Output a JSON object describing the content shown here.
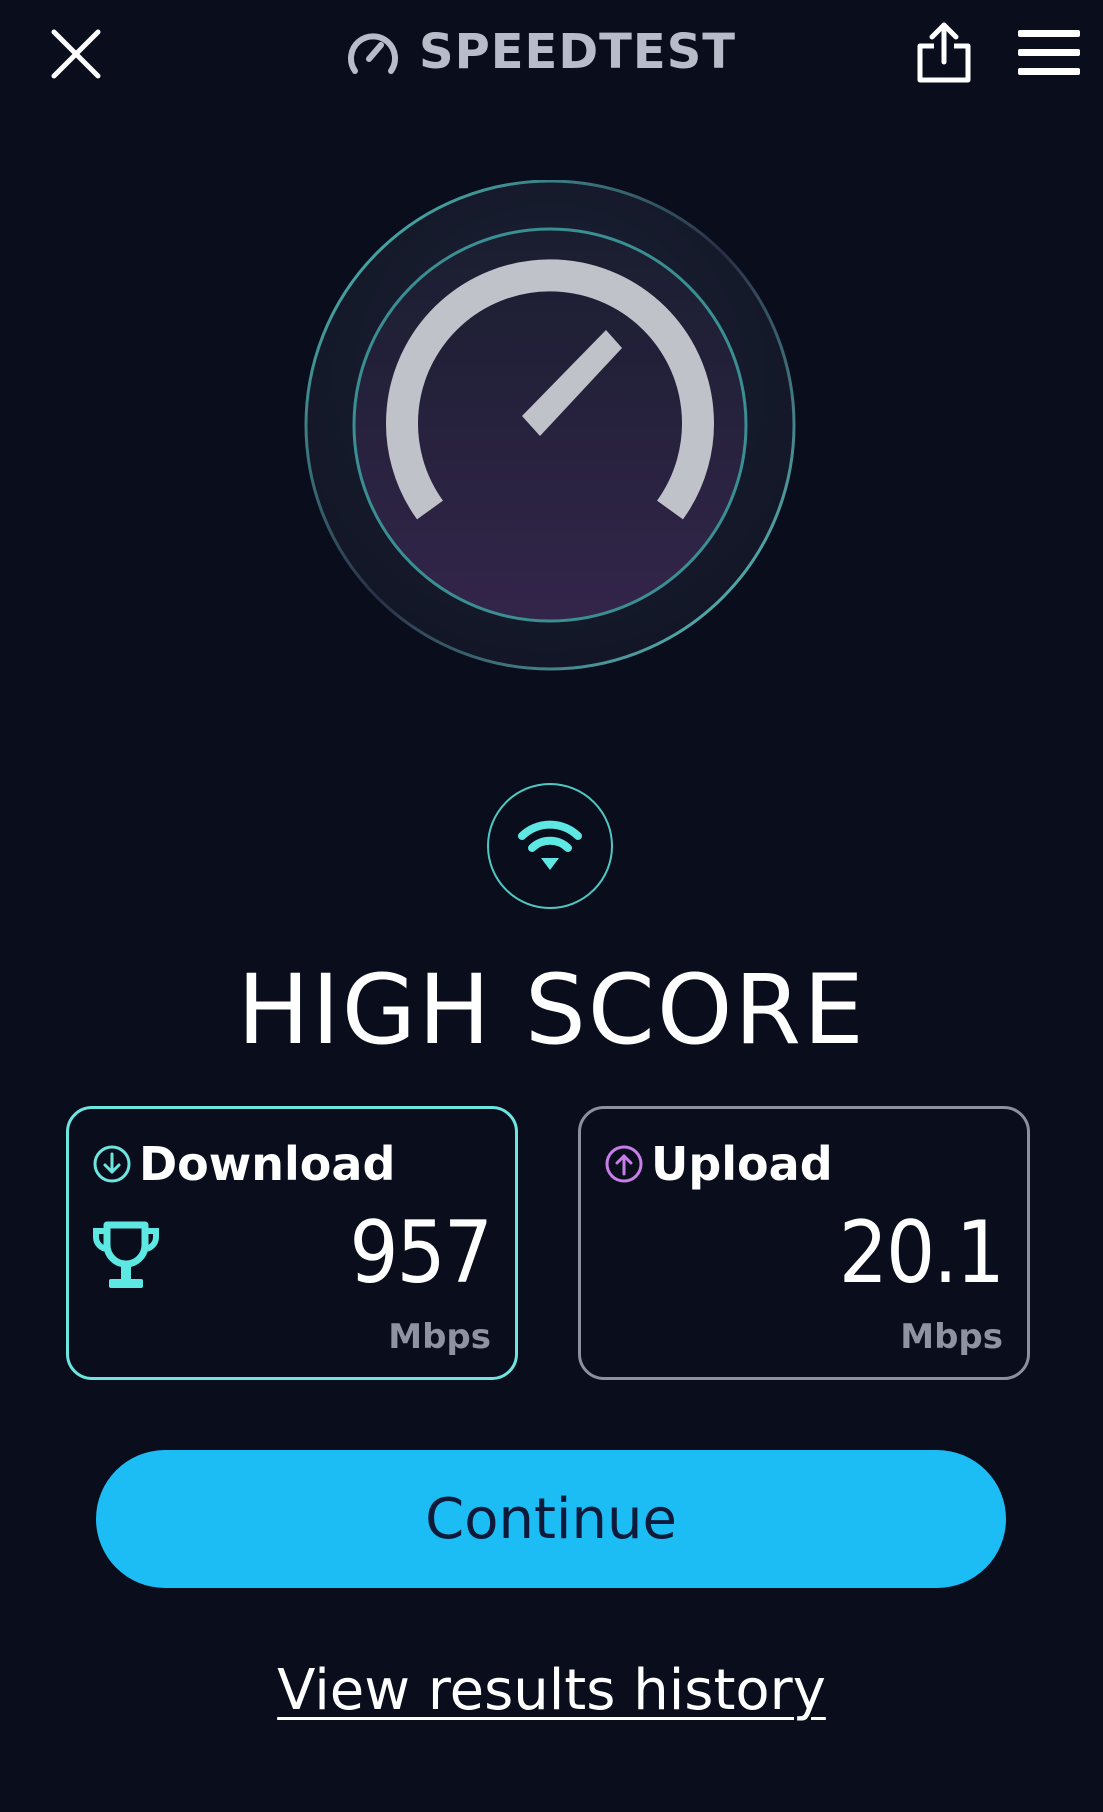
{
  "header": {
    "brand": "SPEEDTEST",
    "close_icon": "close-icon",
    "brand_icon": "speedometer-icon",
    "share_icon": "share-icon",
    "menu_icon": "hamburger-menu-icon"
  },
  "gauge": {
    "icon": "speedometer-gauge-icon"
  },
  "connection": {
    "icon": "wifi-icon"
  },
  "result": {
    "title": "HIGH SCORE"
  },
  "download": {
    "label": "Download",
    "value": "957",
    "unit": "Mbps",
    "icon": "download-arrow-icon",
    "badge_icon": "trophy-icon"
  },
  "upload": {
    "label": "Upload",
    "value": "20.1",
    "unit": "Mbps",
    "icon": "upload-arrow-icon"
  },
  "actions": {
    "continue_label": "Continue",
    "history_label": "View results history"
  },
  "colors": {
    "background": "#0a0d1c",
    "accent_cyan": "#6ee6e0",
    "accent_purple": "#c77ee8",
    "button_blue": "#1cbdf5"
  }
}
